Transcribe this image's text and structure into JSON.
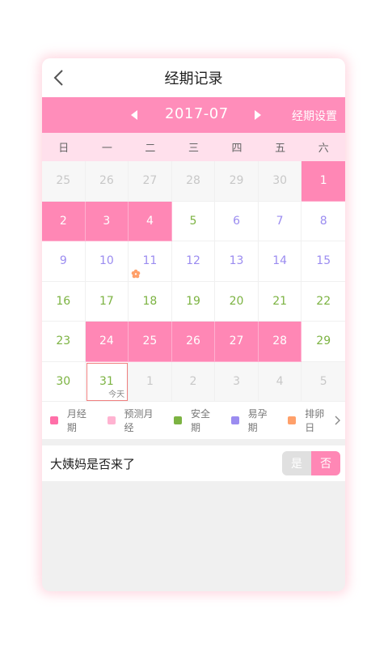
{
  "header": {
    "title": "经期记录"
  },
  "month_bar": {
    "month": "2017-07",
    "settings_label": "经期设置"
  },
  "weekdays": [
    "日",
    "一",
    "二",
    "三",
    "四",
    "五",
    "六"
  ],
  "days": [
    {
      "label": "25",
      "type": "out"
    },
    {
      "label": "26",
      "type": "out"
    },
    {
      "label": "27",
      "type": "out"
    },
    {
      "label": "28",
      "type": "out"
    },
    {
      "label": "29",
      "type": "out"
    },
    {
      "label": "30",
      "type": "out"
    },
    {
      "label": "1",
      "type": "period"
    },
    {
      "label": "2",
      "type": "period"
    },
    {
      "label": "3",
      "type": "period"
    },
    {
      "label": "4",
      "type": "period"
    },
    {
      "label": "5",
      "type": "safe"
    },
    {
      "label": "6",
      "type": "fertile"
    },
    {
      "label": "7",
      "type": "fertile"
    },
    {
      "label": "8",
      "type": "fertile"
    },
    {
      "label": "9",
      "type": "fertile"
    },
    {
      "label": "10",
      "type": "fertile"
    },
    {
      "label": "11",
      "type": "fertile",
      "ovulation": true
    },
    {
      "label": "12",
      "type": "fertile"
    },
    {
      "label": "13",
      "type": "fertile"
    },
    {
      "label": "14",
      "type": "fertile"
    },
    {
      "label": "15",
      "type": "fertile"
    },
    {
      "label": "16",
      "type": "safe"
    },
    {
      "label": "17",
      "type": "safe"
    },
    {
      "label": "18",
      "type": "safe"
    },
    {
      "label": "19",
      "type": "safe"
    },
    {
      "label": "20",
      "type": "safe"
    },
    {
      "label": "21",
      "type": "safe"
    },
    {
      "label": "22",
      "type": "safe"
    },
    {
      "label": "23",
      "type": "safe"
    },
    {
      "label": "24",
      "type": "period"
    },
    {
      "label": "25",
      "type": "period"
    },
    {
      "label": "26",
      "type": "period"
    },
    {
      "label": "27",
      "type": "period"
    },
    {
      "label": "28",
      "type": "period"
    },
    {
      "label": "29",
      "type": "safe"
    },
    {
      "label": "30",
      "type": "safe"
    },
    {
      "label": "31",
      "type": "safe",
      "today": true,
      "sub": "今天"
    },
    {
      "label": "1",
      "type": "out"
    },
    {
      "label": "2",
      "type": "out"
    },
    {
      "label": "3",
      "type": "out"
    },
    {
      "label": "4",
      "type": "out"
    },
    {
      "label": "5",
      "type": "out"
    }
  ],
  "legend": [
    {
      "label": "月经期",
      "color": "#ff6fa8"
    },
    {
      "label": "预测月经",
      "color": "#ffb3d1"
    },
    {
      "label": "安全期",
      "color": "#7cb342"
    },
    {
      "label": "易孕期",
      "color": "#9b8cf0"
    },
    {
      "label": "排卵日",
      "color": "#ffa06a"
    }
  ],
  "question": {
    "text": "大姨妈是否来了",
    "yes_label": "是",
    "no_label": "否",
    "selected": "否"
  },
  "colors": {
    "accent": "#ff8dba",
    "period": "#ff87b5",
    "safe": "#7cb342",
    "fertile": "#9b8cf0",
    "ovulation": "#ffa06a"
  }
}
